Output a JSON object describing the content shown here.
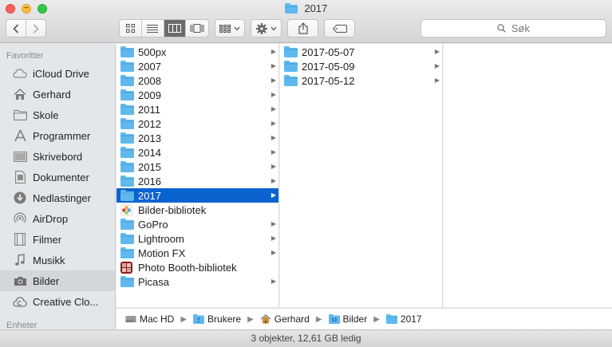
{
  "window": {
    "title": "2017"
  },
  "toolbar": {
    "search_placeholder": "Søk"
  },
  "sidebar": {
    "heading_favorites": "Favoritter",
    "heading_devices": "Enheter",
    "items": [
      {
        "label": "iCloud Drive",
        "icon": "cloud-icon"
      },
      {
        "label": "Gerhard",
        "icon": "home-icon"
      },
      {
        "label": "Skole",
        "icon": "folder-icon"
      },
      {
        "label": "Programmer",
        "icon": "applications-icon"
      },
      {
        "label": "Skrivebord",
        "icon": "desktop-icon"
      },
      {
        "label": "Dokumenter",
        "icon": "document-icon"
      },
      {
        "label": "Nedlastinger",
        "icon": "download-icon"
      },
      {
        "label": "AirDrop",
        "icon": "airdrop-icon"
      },
      {
        "label": "Filmer",
        "icon": "film-icon"
      },
      {
        "label": "Musikk",
        "icon": "music-icon"
      },
      {
        "label": "Bilder",
        "icon": "camera-icon"
      },
      {
        "label": "Creative Clo...",
        "icon": "creative-cloud-icon"
      }
    ]
  },
  "column1": {
    "items": [
      {
        "label": "500px"
      },
      {
        "label": "2007"
      },
      {
        "label": "2008"
      },
      {
        "label": "2009"
      },
      {
        "label": "2011"
      },
      {
        "label": "2012"
      },
      {
        "label": "2013"
      },
      {
        "label": "2014"
      },
      {
        "label": "2015"
      },
      {
        "label": "2016"
      },
      {
        "label": "2017"
      },
      {
        "label": "Bilder-bibliotek"
      },
      {
        "label": "GoPro"
      },
      {
        "label": "Lightroom"
      },
      {
        "label": "Motion FX"
      },
      {
        "label": "Photo Booth-bibliotek"
      },
      {
        "label": "Picasa"
      }
    ]
  },
  "column2": {
    "items": [
      {
        "label": "2017-05-07"
      },
      {
        "label": "2017-05-09"
      },
      {
        "label": "2017-05-12"
      }
    ]
  },
  "pathbar": {
    "crumbs": [
      "Mac HD",
      "Brukere",
      "Gerhard",
      "Bilder",
      "2017"
    ]
  },
  "status": {
    "text": "3 objekter, 12,61 GB ledig"
  },
  "colors": {
    "selection": "#0a63cf",
    "folder": "#5fb9ef"
  }
}
